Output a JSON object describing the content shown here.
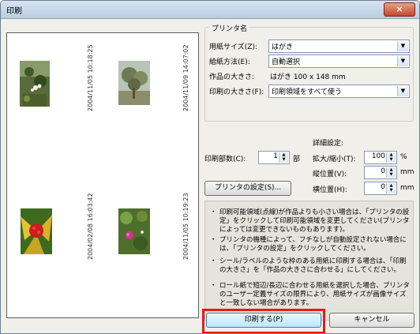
{
  "window": {
    "title": "印刷",
    "close_glyph": "×"
  },
  "photos": [
    {
      "stamp": "2004/11/05 10:18:25",
      "icon": "photo-flower-cluster"
    },
    {
      "stamp": "2004/11/09 14:07:02",
      "icon": "photo-tree"
    },
    {
      "stamp": "2004/02/08 16:03:42",
      "icon": "photo-red-berries"
    },
    {
      "stamp": "2004/11/05 10:19:23",
      "icon": "photo-pink-flower"
    }
  ],
  "printer": {
    "section_label": "プリンタ名",
    "paper_size_label": "用紙サイズ(Z):",
    "paper_size_value": "はがき",
    "feed_label": "給紙方法(E):",
    "feed_value": "自動選択",
    "work_size_label": "作品の大きさ:",
    "work_size_value": "はがき 100 x 148 mm",
    "print_size_label": "印刷の大きさ(F):",
    "print_size_value": "印刷領域をすべて使う"
  },
  "copies": {
    "label": "印刷部数(C):",
    "value": "1",
    "unit": "部"
  },
  "printer_settings_button": "プリンタの設定(S)...",
  "detail": {
    "title": "詳細設定:",
    "scale_label": "拡大/縮小(T):",
    "scale_value": "100",
    "scale_unit": "%",
    "vpos_label": "縦位置(V):",
    "vpos_value": "0",
    "vpos_unit": "mm",
    "hpos_label": "横位置(H):",
    "hpos_value": "0",
    "hpos_unit": "mm"
  },
  "notes": [
    {
      "bullet": "・",
      "text": "印刷可能領域(点線)が作品よりも小さい場合は、「プリンタの設定」をクリックして印刷可能領域を変更してください(プリンタによっては変更できないものもあります)。"
    },
    {
      "bullet": "・",
      "text": "プリンタの機種によって、フチなしが自動設定されない場合には、「プリンタの設定」をクリックしてください。"
    },
    {
      "bullet": "・",
      "text": "シール/ラベルのような枠のある用紙に印刷する場合は、「印刷の大きさ」を「作品の大きさに合わせる」にしてください。"
    },
    {
      "bullet": "・",
      "text": "ロール紙で短辺/長辺に合わせる用紙を選択した場合、プリンタのユーザー定義サイズの限界により、用紙サイズが画像サイズと一致しない場合があります。"
    }
  ],
  "buttons": {
    "print": "印刷する(P)",
    "cancel": "キャンセル"
  },
  "colors": {
    "highlight": "#e81a1a",
    "title_bar": "#c7d8ea"
  }
}
